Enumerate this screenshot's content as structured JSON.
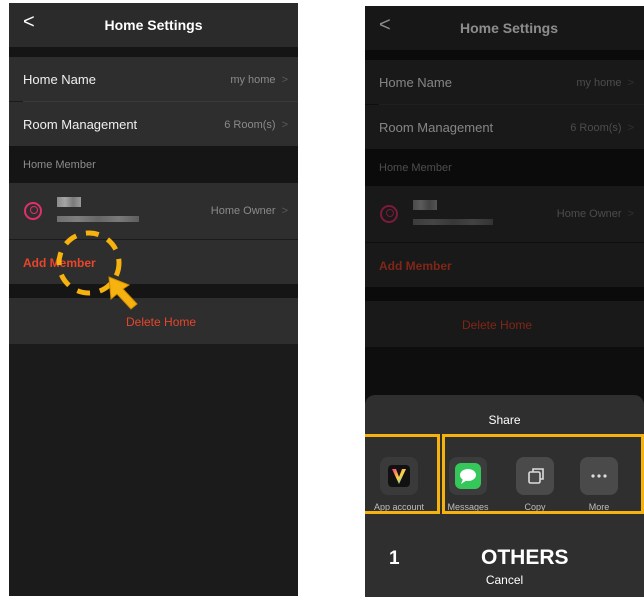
{
  "left": {
    "header": {
      "title": "Home Settings",
      "back": "<"
    },
    "rows": {
      "home_name": {
        "label": "Home Name",
        "value": "my home"
      },
      "room_mgmt": {
        "label": "Room Management",
        "value": "6 Room(s)"
      }
    },
    "member_section": "Home Member",
    "member": {
      "role": "Home Owner"
    },
    "add_member": "Add Member",
    "delete_home": "Delete Home",
    "chevron": ">"
  },
  "right": {
    "header": {
      "title": "Home Settings",
      "back": "<"
    },
    "rows": {
      "home_name": {
        "label": "Home Name",
        "value": "my home"
      },
      "room_mgmt": {
        "label": "Room Management",
        "value": "6 Room(s)"
      }
    },
    "member_section": "Home Member",
    "member": {
      "role": "Home Owner"
    },
    "add_member": "Add Member",
    "delete_home": "Delete Home",
    "chevron": ">",
    "share": {
      "title": "Share",
      "items": [
        {
          "label": "App account",
          "icon": "app-logo-icon"
        },
        {
          "label": "Messages",
          "icon": "messages-icon"
        },
        {
          "label": "Copy",
          "icon": "copy-icon"
        },
        {
          "label": "More",
          "icon": "more-icon"
        }
      ],
      "cancel": "Cancel"
    }
  },
  "annotations": {
    "label_1": "1",
    "label_others": "OTHERS",
    "highlight_color": "#f6b20e"
  },
  "colors": {
    "accent_red": "#e8452b",
    "avatar_pink": "#e0306c",
    "messages_green": "#35c759"
  }
}
